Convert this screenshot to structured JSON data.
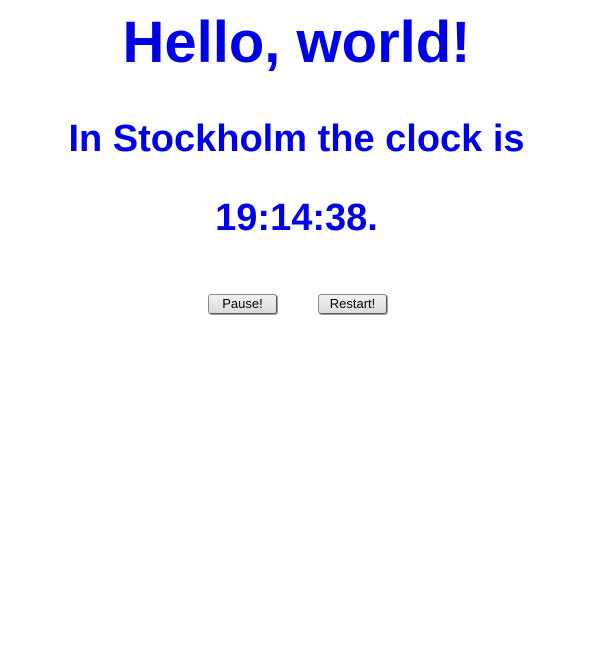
{
  "page": {
    "heading": "Hello, world!",
    "subheading": "In Stockholm the clock is",
    "clock_text": "19:14:38."
  },
  "controls": {
    "pause_label": "Pause!",
    "restart_label": "Restart!"
  },
  "colors": {
    "text_accent": "#0000e6",
    "background": "#ffffff"
  }
}
